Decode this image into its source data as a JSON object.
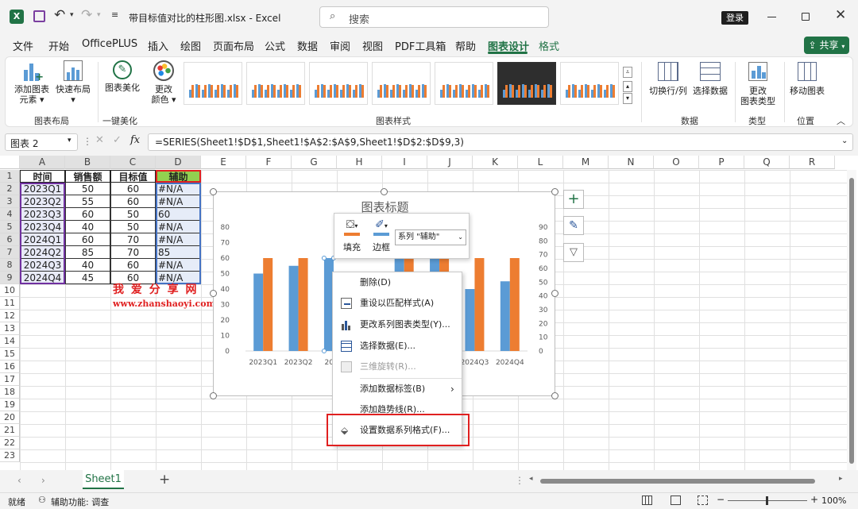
{
  "title": {
    "filename": "带目标值对比的柱形图.xlsx",
    "sep": "-",
    "app": "Excel",
    "search_placeholder": "搜索",
    "login": "登录"
  },
  "menu_tabs": [
    "文件",
    "开始",
    "OfficePLUS",
    "插入",
    "绘图",
    "页面布局",
    "公式",
    "数据",
    "审阅",
    "视图",
    "PDF工具箱",
    "帮助",
    "图表设计",
    "格式"
  ],
  "share": "共享",
  "ribbon": {
    "add_element": "添加图表",
    "add_element2": "元素",
    "quick_layout": "快速布局",
    "beautify": "图表美化",
    "change_color": "更改",
    "change_color2": "颜色",
    "group_layout": "图表布局",
    "group_beautify": "一键美化",
    "group_styles": "图表样式",
    "switch_rowcol": "切换行/列",
    "select_data": "选择数据",
    "group_data": "数据",
    "change_type": "更改",
    "change_type2": "图表类型",
    "group_type": "类型",
    "move_chart": "移动图表",
    "group_location": "位置"
  },
  "formula_bar": {
    "name_box": "图表 2",
    "fx": "fx",
    "formula": "=SERIES(Sheet1!$D$1,Sheet1!$A$2:$A$9,Sheet1!$D$2:$D$9,3)"
  },
  "columns": [
    "A",
    "B",
    "C",
    "D",
    "E",
    "F",
    "G",
    "H",
    "I",
    "J",
    "K",
    "L",
    "M",
    "N",
    "O",
    "P",
    "Q",
    "R"
  ],
  "rows": [
    "1",
    "2",
    "3",
    "4",
    "5",
    "6",
    "7",
    "8",
    "9",
    "10",
    "11",
    "12",
    "13",
    "14",
    "15",
    "16",
    "17",
    "18",
    "19",
    "20",
    "21",
    "22",
    "23"
  ],
  "table": {
    "headers": [
      "时间",
      "销售额",
      "目标值",
      "辅助"
    ],
    "data": [
      [
        "2023Q1",
        "50",
        "60",
        "#N/A"
      ],
      [
        "2023Q2",
        "55",
        "60",
        "#N/A"
      ],
      [
        "2023Q3",
        "60",
        "50",
        "60"
      ],
      [
        "2023Q4",
        "40",
        "50",
        "#N/A"
      ],
      [
        "2024Q1",
        "60",
        "70",
        "#N/A"
      ],
      [
        "2024Q2",
        "85",
        "70",
        "85"
      ],
      [
        "2024Q3",
        "40",
        "60",
        "#N/A"
      ],
      [
        "2024Q4",
        "45",
        "60",
        "#N/A"
      ]
    ]
  },
  "watermark": {
    "cn": "我 爱 分 享 网",
    "url": "www.zhanshaoyi.com"
  },
  "chart_data": {
    "type": "bar",
    "title": "图表标题",
    "categories": [
      "2023Q1",
      "2023Q2",
      "2023Q3",
      "2023Q4",
      "2024Q1",
      "2024Q2",
      "2024Q3",
      "2024Q4"
    ],
    "series": [
      {
        "values": [
          50,
          55,
          60,
          40,
          60,
          85,
          40,
          45
        ],
        "color": "#5b9bd5"
      },
      {
        "values": [
          60,
          60,
          50,
          50,
          70,
          70,
          60,
          60
        ],
        "color": "#ed7d31"
      }
    ],
    "left_axis_ticks": [
      "0",
      "10",
      "20",
      "30",
      "40",
      "50",
      "60",
      "70",
      "80"
    ],
    "right_axis_ticks": [
      "0",
      "10",
      "20",
      "30",
      "40",
      "50",
      "60",
      "70",
      "80",
      "90"
    ],
    "ylim": [
      0,
      80
    ],
    "visible_category_labels": [
      "2023Q1",
      "2023Q2",
      "2023",
      "2024Q3",
      "2024Q4"
    ]
  },
  "mini_toolbar": {
    "fill": "填充",
    "border": "边框",
    "series_select": "系列 \"辅助\""
  },
  "context_menu": [
    "删除(D)",
    "重设以匹配样式(A)",
    "更改系列图表类型(Y)...",
    "选择数据(E)...",
    "三维旋转(R)...",
    "添加数据标签(B)",
    "添加趋势线(R)...",
    "设置数据系列格式(F)..."
  ],
  "sheet_tab": "Sheet1",
  "status": {
    "ready": "就绪",
    "accessibility": "辅助功能: 调查",
    "zoom": "100%"
  },
  "colors": {
    "accent": "#217346",
    "highlight_box": "#e02020",
    "blue": "#5b9bd5",
    "orange": "#ed7d31"
  }
}
